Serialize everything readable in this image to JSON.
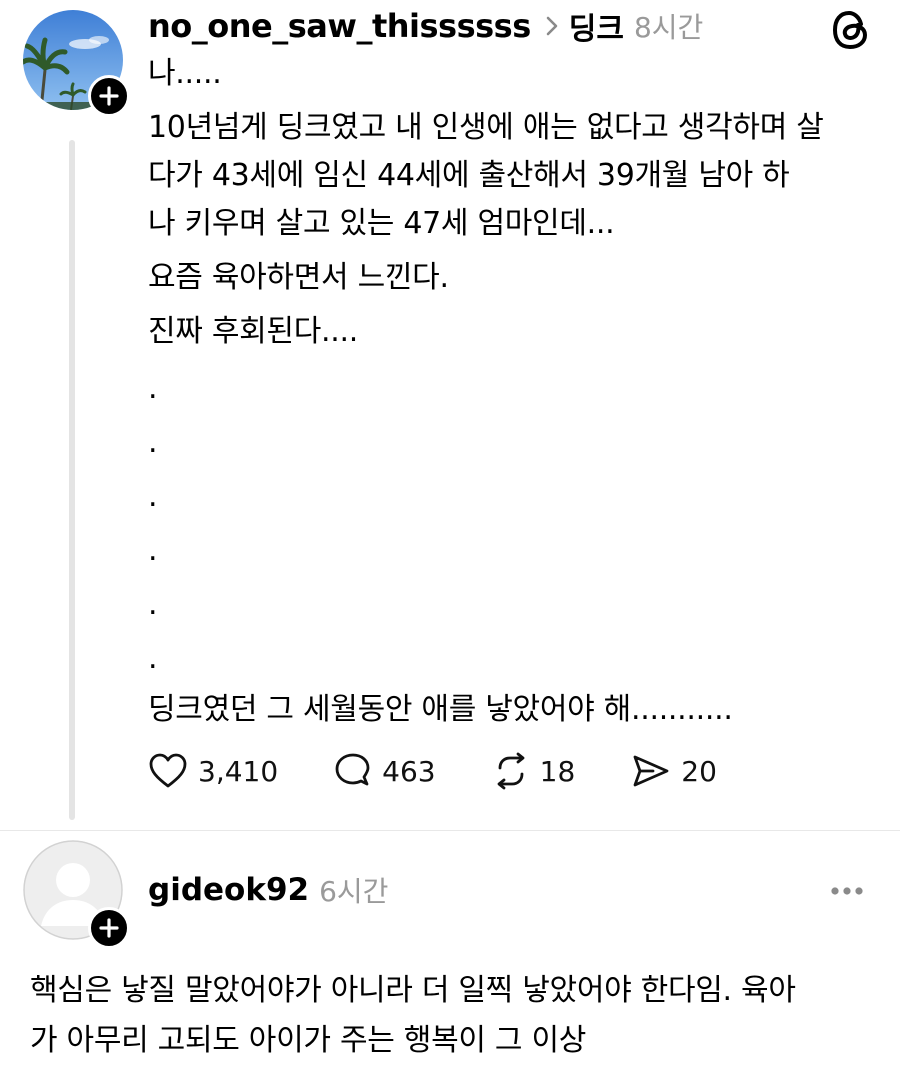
{
  "post": {
    "username": "no_one_saw_thissssss",
    "topic": "딩크",
    "time": "8시간",
    "lines": {
      "l1": "나.....",
      "l2": "10년넘게 딩크였고 내 인생에 애는 없다고 생각하며 살",
      "l3": "다가 43세에 임신 44세에 출산해서 39개월 남아 하",
      "l4": "나 키우며 살고 있는 47세 엄마인데...",
      "l5": "요즘 육아하면서 느낀다.",
      "l6": "진짜 후회된다....",
      "dot": ".",
      "l7": "딩크였던 그 세월동안 애를 낳았어야 해..........."
    },
    "stats": {
      "likes": "3,410",
      "comments": "463",
      "reposts": "18",
      "shares": "20"
    }
  },
  "reply": {
    "username": "gideok92",
    "time": "6시간",
    "lines": {
      "l1": "핵심은 낳질 말았어야가 아니라 더 일찍 낳았어야 한다임. 육아",
      "l2": "가 아무리 고되도 아이가 주는 행복이 그 이상"
    }
  },
  "icons": {
    "post_avatar": "palm-tree-sky-photo",
    "follow": "plus-icon",
    "chevron": "chevron-right-icon",
    "threads": "threads-logo-icon",
    "like": "heart-icon",
    "comment": "comment-bubble-icon",
    "repost": "repost-icon",
    "share": "send-icon",
    "reply_avatar": "default-avatar-icon",
    "more": "more-dots-icon"
  },
  "colors": {
    "text": "#000000",
    "muted": "#9a9a9a",
    "thread_line": "#e4e4e4",
    "badge": "#000000"
  }
}
